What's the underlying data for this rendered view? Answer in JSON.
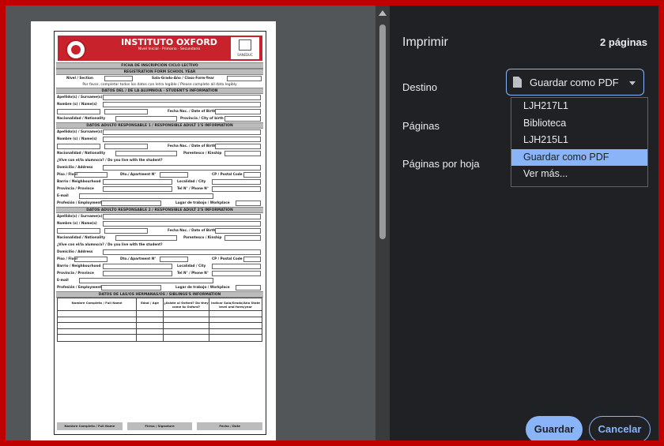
{
  "panel": {
    "title": "Imprimir",
    "page_count": "2 páginas",
    "destination_label": "Destino",
    "destination_value": "Guardar como PDF",
    "pages_label": "Páginas",
    "pages_per_sheet_label": "Páginas por hoja",
    "menu": [
      "LJH217L1",
      "Biblioteca",
      "LJH215L1",
      "Guardar como PDF",
      "Ver más..."
    ],
    "save_label": "Guardar",
    "cancel_label": "Cancelar"
  },
  "doc": {
    "school": "INSTITUTO OXFORD",
    "school_sub": "Nivel Inicial · Primario · Secundario",
    "logo_caption": "SANEDUC",
    "title_line1": "FICHA DE INSCRIPCIÓN CICLO LECTIVO",
    "title_line2": "REGISTRATION FORM SCHOOL YEAR",
    "level_label": "Nivel / Section",
    "grade_label": "Sala-Grado-Año / Class-Form-Year",
    "instructions": "Por favor, completar todos los datos con letra legible / Please complete all data legibly",
    "sec_student": "DATOS DEL / DE LA ALUMNO/A - STUDENT'S INFORMATION",
    "sec_adult1": "DATOS ADULTO RESPONSABLE 1 / RESPONSIBLE ADULT 1'S INFORMATION",
    "sec_adult2": "DATOS ADULTO RESPONSABLE 2 / RESPONSIBLE ADULT 2'S INFORMATION",
    "sec_siblings": "DATOS DE LAS/OS HERMANAS/OS / SIBLINGS'S INFORMATION",
    "f_surname": "Apellido(s) / Surname(s)",
    "f_names": "Nombre (s) / Name(s)",
    "f_dob": "Fecha Nac. / Date of Birth",
    "f_nationality": "Nacionalidad / Nationality",
    "f_province_birth": "Provincia / City of birth",
    "f_kinship": "Parentesco / Kinship",
    "f_lives": "¿Vive con el/la alumno/a? / Do you live with the student?",
    "f_address": "Domicilio / Address",
    "f_floor": "Piso / Floor",
    "f_apartment": "Dto./ Apartment N°",
    "f_postal": "CP / Postal Code",
    "f_neighbourhood": "Barrio / Neighbourhood",
    "f_city": "Localidad / City",
    "f_province": "Provincia / Province",
    "f_phone": "Tel N° / Phone N°",
    "f_email": "E-mail",
    "f_employment": "Profesión / Employment",
    "f_workplace": "Lugar de trabajo / Workplace",
    "th_name": "Nombre Completo / Full Name",
    "th_age": "Edad / Age",
    "th_oxford": "¿Asiste al Oxford? Do they come to Oxford?",
    "th_grade": "Indicar Sala/Grado/Año State level and form/year",
    "foot_name": "Nombre Completo / Full Name",
    "foot_signature": "Firma / Signature",
    "foot_date": "Fecha / Date"
  }
}
